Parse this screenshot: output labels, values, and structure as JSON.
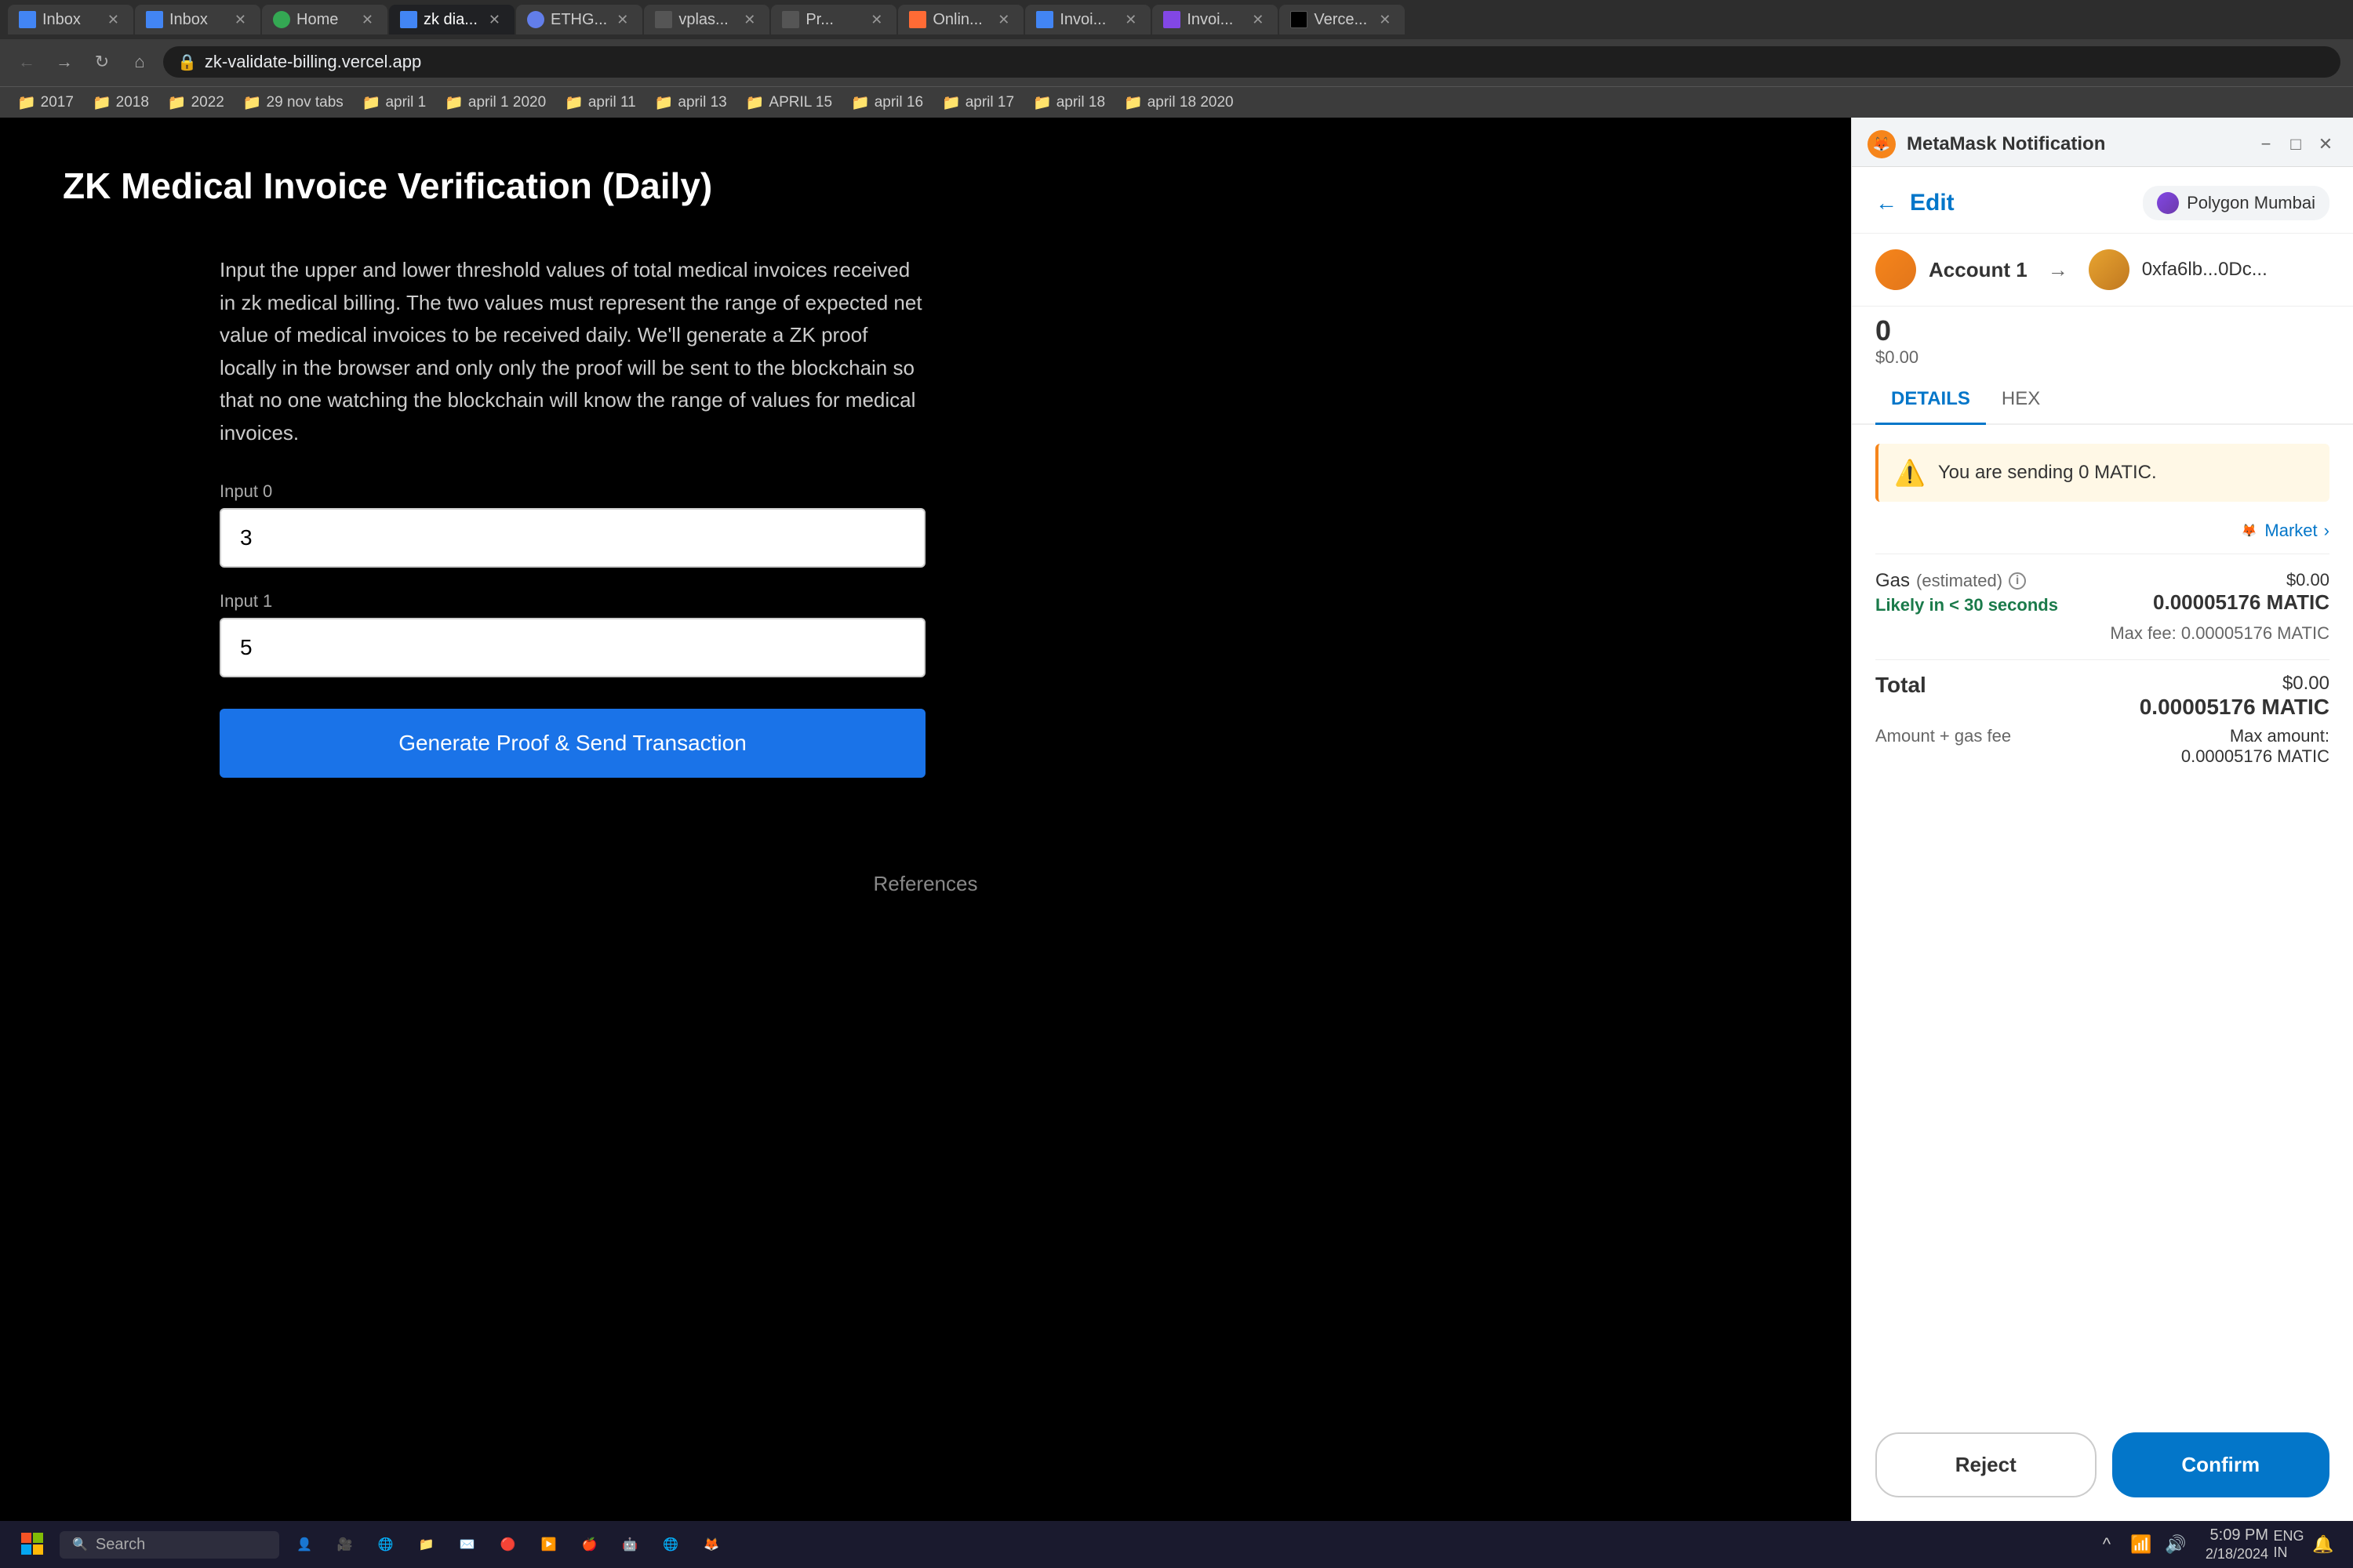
{
  "browser": {
    "address": "zk-validate-billing.vercel.app",
    "tabs": [
      {
        "label": "Inbox",
        "favicon_color": "#4285f4",
        "active": false
      },
      {
        "label": "Inbox",
        "favicon_color": "#4285f4",
        "active": false
      },
      {
        "label": "Home",
        "favicon_color": "#34a853",
        "active": false
      },
      {
        "label": "zk dia...",
        "favicon_color": "#4285f4",
        "active": true
      },
      {
        "label": "ETHG...",
        "favicon_color": "#627eea",
        "active": false
      },
      {
        "label": "vplas...",
        "favicon_color": "#333",
        "active": false
      },
      {
        "label": "Pr...",
        "favicon_color": "#333",
        "active": false
      },
      {
        "label": "Onlin...",
        "favicon_color": "#ff6b35",
        "active": false
      },
      {
        "label": "Invoi...",
        "favicon_color": "#4285f4",
        "active": false
      },
      {
        "label": "Invoi...",
        "favicon_color": "#8247e5",
        "active": false
      },
      {
        "label": "Verce...",
        "favicon_color": "#000",
        "active": false
      }
    ],
    "bookmarks": [
      "2017",
      "2018",
      "2022",
      "29 nov tabs",
      "april 1",
      "april 1 2020",
      "april 11",
      "april 13",
      "APRIL 15",
      "april 16",
      "april 17",
      "april 18",
      "april 18 2020"
    ]
  },
  "webpage": {
    "title": "ZK Medical Invoice Verification (Daily)",
    "description": "Input the upper and lower threshold values of total medical invoices received in zk medical billing. The two values must represent the range of expected net value of medical invoices to be received daily. We'll generate a ZK proof locally in the browser and only only the proof will be sent to the blockchain so that no one watching the blockchain will know the range of values for medical invoices.",
    "input0_label": "Input 0",
    "input0_value": "3",
    "input1_label": "Input 1",
    "input1_value": "5",
    "generate_btn": "Generate Proof & Send Transaction",
    "references_label": "References"
  },
  "metamask": {
    "notification_title": "MetaMask Notification",
    "back_label": "Edit",
    "network": "Polygon Mumbai",
    "account_name": "Account 1",
    "account_address": "0xfa6lb...0Dc...",
    "amount_0": "0",
    "amount_usd": "$0.00",
    "tabs": [
      "DETAILS",
      "HEX"
    ],
    "active_tab": "DETAILS",
    "warning_text": "You are sending 0 MATIC.",
    "market_label": "Market",
    "gas_label": "Gas",
    "estimated_label": "(estimated)",
    "gas_usd": "$0.00",
    "gas_matic": "0.00005176 MATIC",
    "likely_text": "Likely in < 30 seconds",
    "max_fee_label": "Max fee:",
    "max_fee_value": "0.00005176 MATIC",
    "total_label": "Total",
    "total_usd": "$0.00",
    "total_matic": "0.00005176 MATIC",
    "amount_gas_label": "Amount + gas fee",
    "max_amount_label": "Max amount:",
    "max_amount_value": "0.00005176 MATIC",
    "reject_btn": "Reject",
    "confirm_btn": "Confirm"
  },
  "taskbar": {
    "search_placeholder": "Search",
    "time": "5:09 PM",
    "date": "2/18/2024",
    "language": "ENG IN"
  }
}
